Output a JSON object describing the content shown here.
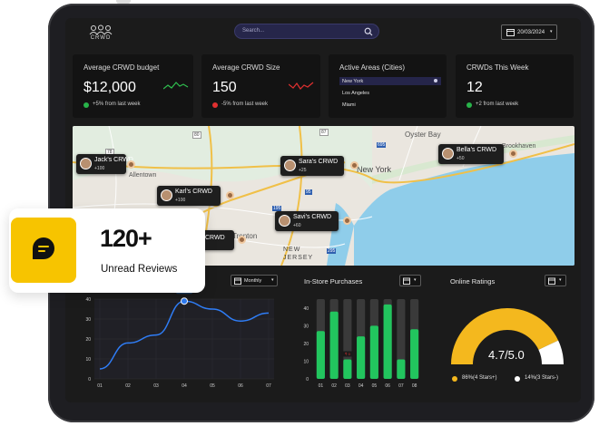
{
  "header": {
    "logo_text": "CRWD",
    "search_placeholder": "Search...",
    "date": "20/03/2024"
  },
  "cards": [
    {
      "title": "Average CRWD budget",
      "value": "$12,000",
      "note": "+5% from last week",
      "trend": "up",
      "color": "#28b34a"
    },
    {
      "title": "Average CRWD Size",
      "value": "150",
      "note": "-5% from last week",
      "trend": "down",
      "color": "#e03030"
    },
    {
      "title": "Active Areas (Cities)",
      "items": [
        "New York",
        "Los Angeles",
        "Miami"
      ],
      "selected": "New York"
    },
    {
      "title": "CRWDs This Week",
      "value": "12",
      "note": "+2 from last week",
      "trend": "up",
      "color": "#28b34a"
    }
  ],
  "map": {
    "labels": [
      "Oyster Bay",
      "Brookhaven",
      "New York",
      "Allentown",
      "Trenton",
      "NEW JERSEY",
      "78",
      "80",
      "87",
      "95",
      "195",
      "295",
      "695"
    ],
    "pins": [
      {
        "name": "Jack's CRWD",
        "count": "+100"
      },
      {
        "name": "Sara's CRWD",
        "count": "+25"
      },
      {
        "name": "Bella's CRWD",
        "count": "+50"
      },
      {
        "name": "Karl's CRWD",
        "count": "+100"
      },
      {
        "name": "Savi's CRWD",
        "count": "+60"
      },
      {
        "name": "CRWD",
        "count": ""
      }
    ]
  },
  "popup": {
    "number": "120+",
    "label": "Unread Reviews"
  },
  "panels": {
    "line": {
      "select": "Monthly",
      "point_label": "39"
    },
    "bars": {
      "title": "In-Store Purchases",
      "hover_label": "₹ 0"
    },
    "ratings": {
      "title": "Online Ratings",
      "value": "4.7/5.0",
      "legend": [
        "86%(4 Stars+)",
        "14%(3 Stars-)"
      ],
      "share": 0.86,
      "colors": [
        "#f4b81e",
        "#ffffff"
      ]
    }
  },
  "chart_data": [
    {
      "type": "line",
      "x": [
        "01",
        "02",
        "03",
        "04",
        "05",
        "06",
        "07"
      ],
      "y": [
        5,
        18,
        22,
        39,
        35,
        29,
        33
      ],
      "ylim": [
        0,
        40
      ],
      "yticks": [
        "0",
        "10",
        "20",
        "30",
        "40"
      ],
      "color": "#2f7df6"
    },
    {
      "type": "bar",
      "categories": [
        "01",
        "02",
        "03",
        "04",
        "05",
        "06",
        "07",
        "08"
      ],
      "values": [
        27,
        38,
        11,
        24,
        30,
        42,
        11,
        28
      ],
      "ylim": [
        0,
        45
      ],
      "yticks": [
        "0",
        "10",
        "20",
        "30",
        "40"
      ],
      "color": "#22c55e"
    }
  ]
}
